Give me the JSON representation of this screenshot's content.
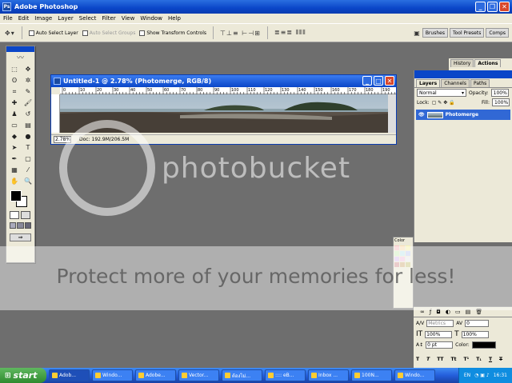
{
  "window": {
    "title": "Adobe Photoshop"
  },
  "menu": [
    "File",
    "Edit",
    "Image",
    "Layer",
    "Select",
    "Filter",
    "View",
    "Window",
    "Help"
  ],
  "options": {
    "auto_select_layer": "Auto Select Layer",
    "auto_select_groups": "Auto Select Groups",
    "show_transform_controls": "Show Transform Controls",
    "palette_tabs": [
      "Brushes",
      "Tool Presets",
      "Comps"
    ]
  },
  "document": {
    "title": "Untitled-1 @ 2.78% (Photomerge, RGB/8)",
    "zoom": "2.78%",
    "doc_size": "Doc: 192.9M/206.5M",
    "ruler_ticks": [
      "0",
      "10",
      "20",
      "30",
      "40",
      "50",
      "60",
      "70",
      "80",
      "90",
      "100",
      "110",
      "120",
      "130",
      "140",
      "150",
      "160",
      "170",
      "180",
      "190"
    ]
  },
  "history_tabs": [
    "History",
    "Actions"
  ],
  "layers_panel": {
    "tabs": [
      "Layers",
      "Channels",
      "Paths"
    ],
    "blend_mode": "Normal",
    "opacity_label": "Opacity:",
    "opacity": "100%",
    "lock_label": "Lock:",
    "fill_label": "Fill:",
    "fill": "100%",
    "layer_name": "Photomerge"
  },
  "color_tab": "Color",
  "character": {
    "font_metrics": "Metrics",
    "font_size": "100%",
    "vscale": "100%",
    "baseline": "0 pt",
    "color_label": "Color:"
  },
  "watermark": {
    "brand": "photobucket",
    "slogan": "Protect more of your memories for less!"
  },
  "taskbar": {
    "start": "start",
    "tasks": [
      "Adob...",
      "Windo...",
      "Adobe...",
      "Vector...",
      "ต้องไม่...",
      ":::: eB...",
      "Inbox ...",
      "100N...",
      "Windo..."
    ],
    "lang": "EN",
    "time": "16:31"
  }
}
